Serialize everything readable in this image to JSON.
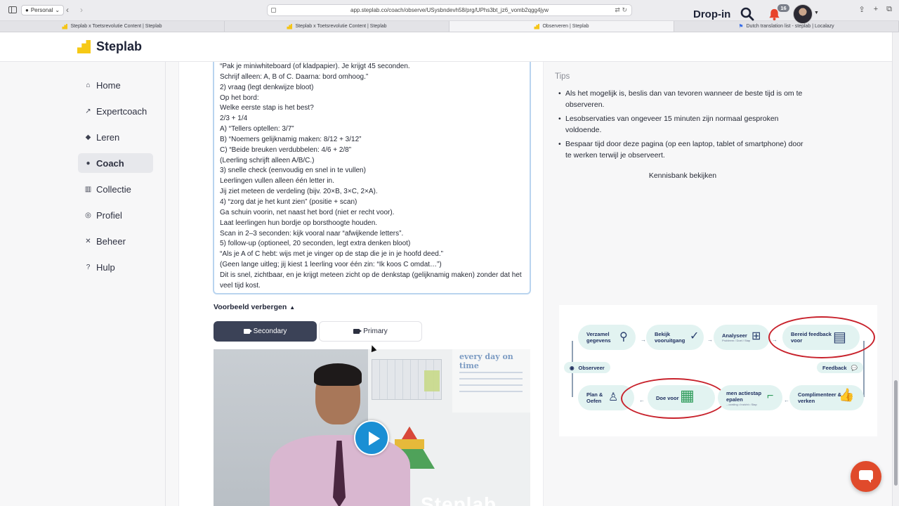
{
  "browser": {
    "profile": "Personal",
    "url": "app.steplab.co/coach/observe/USysbndevh58/prg/UPhs3bt_jz6_vomb2qgg4jyw",
    "tabs": [
      {
        "title": "Steplab x Toetsrevolutie Content | Steplab",
        "active": false
      },
      {
        "title": "Steplab x Toetsrevolutie Content | Steplab",
        "active": false
      },
      {
        "title": "Observeren | Steplab",
        "active": true
      },
      {
        "title": "Dutch translation list - steplab | Localazy",
        "active": false
      }
    ]
  },
  "header": {
    "brand": "Steplab",
    "dropin_label": "Drop-in",
    "notification_count": "16"
  },
  "nav": {
    "items": [
      {
        "label": "Home",
        "icon": "home-icon",
        "active": false
      },
      {
        "label": "Expertcoach",
        "icon": "chart-icon",
        "active": false
      },
      {
        "label": "Leren",
        "icon": "graduation-cap-icon",
        "active": false
      },
      {
        "label": "Coach",
        "icon": "chat-bubble-icon",
        "active": true
      },
      {
        "label": "Collectie",
        "icon": "books-icon",
        "active": false
      },
      {
        "label": "Profiel",
        "icon": "user-circle-icon",
        "active": false
      },
      {
        "label": "Beheer",
        "icon": "tools-icon",
        "active": false
      },
      {
        "label": "Hulp",
        "icon": "question-circle-icon",
        "active": false
      }
    ]
  },
  "example": {
    "lines": [
      "“Pak je miniwhiteboard (of kladpapier). Je krijgt 45 seconden.",
      "Schrijf alleen: A, B of C. Daarna: bord omhoog.”",
      "2) vraag (legt denkwijze bloot)",
      "Op het bord:",
      "Welke eerste stap is het best?",
      "2/3 + 1/4",
      "A) “Tellers optellen: 3/7”",
      "B) “Noemers gelijknamig maken: 8/12 + 3/12”",
      "C) “Beide breuken verdubbelen: 4/6 + 2/8”",
      "(Leerling schrijft alleen A/B/C.)",
      "3) snelle check (eenvoudig en snel in te vullen)",
      "Leerlingen vullen alleen één letter in.",
      "Jij ziet meteen de verdeling (bijv. 20×B, 3×C, 2×A).",
      "4) “zorg dat je het kunt zien” (positie + scan)",
      "Ga schuin voorin, net naast het bord (niet er recht voor).",
      "Laat leerlingen hun bordje op borsthoogte houden.",
      "Scan in 2–3 seconden: kijk vooral naar “afwijkende letters”.",
      "5) follow-up (optioneel, 20 seconden, legt extra denken bloot)",
      "“Als je A of C hebt: wijs met je vinger op de stap die je in je hoofd deed.”",
      "(Geen lange uitleg; jij kiest 1 leerling voor één zin: “Ik koos C omdat…”)"
    ],
    "last_line": "Dit is snel, zichtbaar, en je krijgt meteen zicht op de denkstap (gelijknamig maken) zonder dat het veel tijd kost.",
    "toggle_label": "Voorbeeld verbergen",
    "secondary_label": "Secondary",
    "primary_label": "Primary",
    "video_poster_text": "every day on time",
    "video_brand": "Steplab"
  },
  "tips": {
    "title": "Tips",
    "items": [
      "Als het mogelijk is, beslis dan van tevoren wanneer de beste tijd is om te observeren.",
      "Lesobservaties van ongeveer 15 minuten zijn normaal gesproken voldoende.",
      "Bespaar tijd door deze pagina (op een laptop, tablet of smartphone) door te werken terwijl je observeert."
    ],
    "kb_button": "Kennisbank bekijken"
  },
  "diagram": {
    "steps": {
      "gather": "Verzamel gegevens",
      "progress": "Bekijk vooruitgang",
      "analyse": "Analyseer",
      "analyse_sub": "Probleem / Doel / Stap",
      "prepare": "Bereid feedback voor",
      "observe": "Observeer",
      "feedback": "Feedback",
      "plan": "Plan & Oefen",
      "model": "Doe voor",
      "action": "men actiestap epalen",
      "action_sub": "...oording • Inzicht • Stap",
      "praise": "Complimenteer & verken"
    },
    "colors": {
      "pill": "#e2f3f1",
      "ring": "#c8222c",
      "text": "#203060"
    }
  },
  "colors": {
    "accent": "#f6c915",
    "primary_button": "#3b4257",
    "play_button": "#1a8fd4",
    "chat_fab": "#e04a2b"
  }
}
